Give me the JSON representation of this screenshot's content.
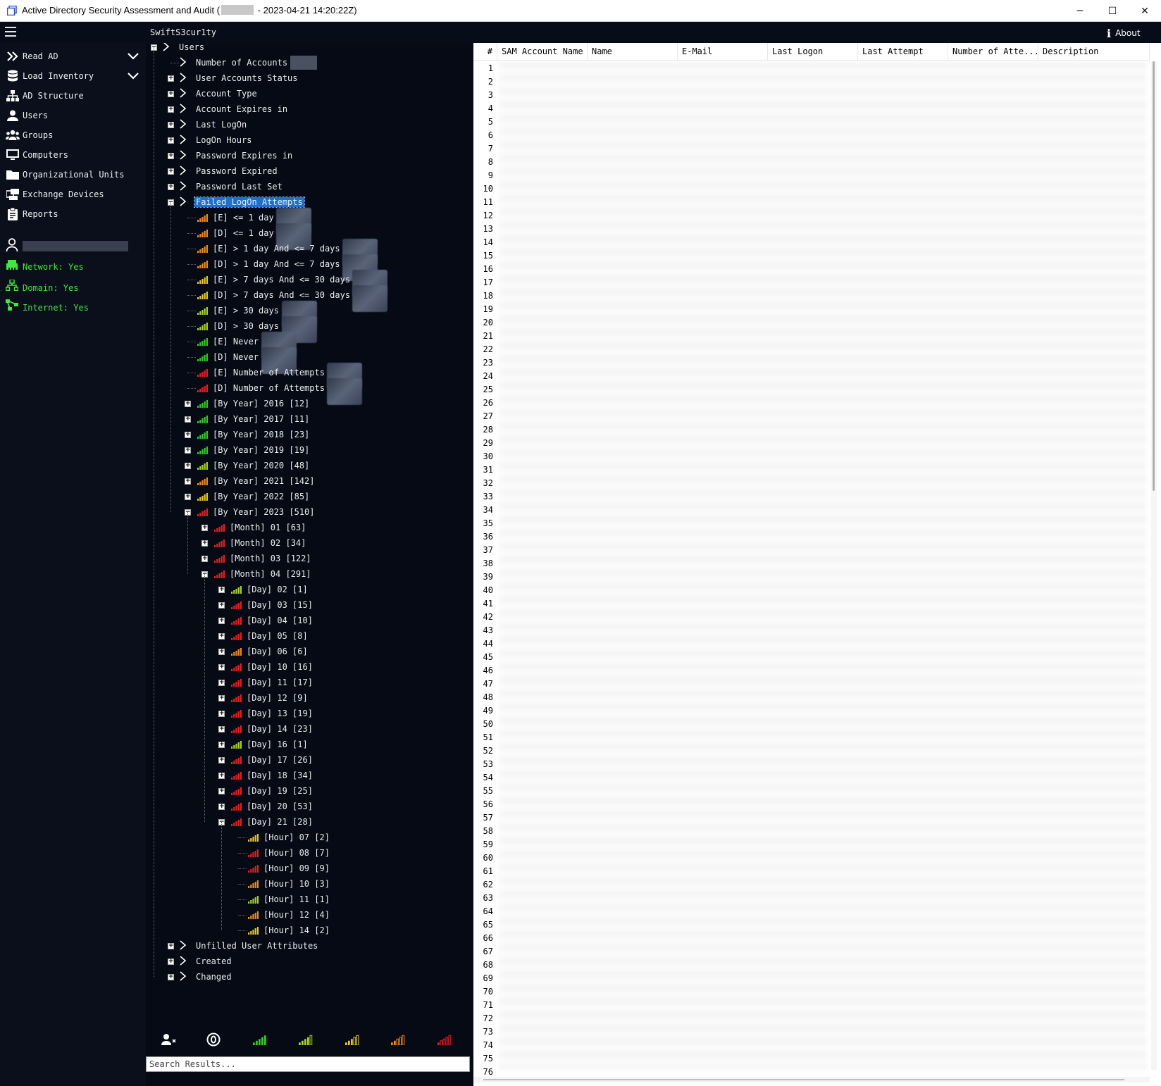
{
  "window": {
    "title_prefix": "Active Directory Security Assessment and Audit (",
    "title_suffix": " - 2023-04-21 14:20:22Z)",
    "minimize": "─",
    "maximize": "☐",
    "close": "✕"
  },
  "header": {
    "brand": "SwiftS3cur1ty",
    "about": "About"
  },
  "nav": {
    "items": [
      {
        "label": "Read AD",
        "icon": "chevrons-right-icon",
        "expandable": true
      },
      {
        "label": "Load Inventory",
        "icon": "database-icon",
        "expandable": true
      },
      {
        "label": "AD Structure",
        "icon": "sitemap-icon"
      },
      {
        "label": "Users",
        "icon": "user-icon"
      },
      {
        "label": "Groups",
        "icon": "users-icon"
      },
      {
        "label": "Computers",
        "icon": "monitor-icon"
      },
      {
        "label": "Organizational Units",
        "icon": "folder-icon"
      },
      {
        "label": "Exchange Devices",
        "icon": "exchange-icon"
      },
      {
        "label": "Reports",
        "icon": "clipboard-icon"
      }
    ],
    "status": {
      "network": "Network: Yes",
      "domain": "Domain: Yes",
      "internet": "Internet: Yes"
    }
  },
  "tree": {
    "root": "Users",
    "categories": [
      "Number of Accounts",
      "User Accounts Status",
      "Account Type",
      "Account Expires in",
      "Last LogOn",
      "LogOn Hours",
      "Password Expires in",
      "Password Expired",
      "Password Last Set",
      "Failed LogOn Attempts"
    ],
    "failed_children": [
      "[E] <= 1 day",
      "[D] <= 1 day",
      "[E] > 1 day And <= 7 days",
      "[D] > 1 day And <= 7 days",
      "[E] > 7 days And <= 30 days",
      "[D] > 7 days And <= 30 days",
      "[E] > 30 days",
      "[D] > 30 days",
      "[E] Never",
      "[D] Never",
      "[E] Number of Attempts",
      "[D] Number of Attempts"
    ],
    "years": [
      "[By Year] 2016 [12]",
      "[By Year] 2017 [11]",
      "[By Year] 2018 [23]",
      "[By Year] 2019 [19]",
      "[By Year] 2020 [48]",
      "[By Year] 2021 [142]",
      "[By Year] 2022 [85]",
      "[By Year] 2023 [510]"
    ],
    "months": [
      "[Month] 01 [63]",
      "[Month] 02 [34]",
      "[Month] 03 [122]",
      "[Month] 04 [291]"
    ],
    "days": [
      "[Day] 02 [1]",
      "[Day] 03 [15]",
      "[Day] 04 [10]",
      "[Day] 05 [8]",
      "[Day] 06 [6]",
      "[Day] 10 [16]",
      "[Day] 11 [17]",
      "[Day] 12 [9]",
      "[Day] 13 [19]",
      "[Day] 14 [23]",
      "[Day] 16 [1]",
      "[Day] 17 [26]",
      "[Day] 18 [34]",
      "[Day] 19 [25]",
      "[Day] 20 [53]",
      "[Day] 21 [28]"
    ],
    "hours": [
      "[Hour] 07 [2]",
      "[Hour] 08 [7]",
      "[Hour] 09 [9]",
      "[Hour] 10 [3]",
      "[Hour] 11 [1]",
      "[Hour] 12 [4]",
      "[Hour] 14 [2]"
    ],
    "trailing": [
      "Unfilled User Attributes",
      "Created",
      "Changed"
    ]
  },
  "search": {
    "placeholder": "Search Results..."
  },
  "grid": {
    "columns": [
      "#",
      "SAM Account Name",
      "Name",
      "E-Mail",
      "Last Logon",
      "Last Attempt",
      "Number of Atte...",
      "Description"
    ],
    "row_count": 76
  },
  "colors": {
    "green": "#2ecc1e",
    "yellowgreen": "#a8d21c",
    "yellow": "#e8c816",
    "orange": "#f08a12",
    "red": "#e81e1e",
    "selection": "#1e6fd0",
    "status_green": "#3ee83e"
  }
}
